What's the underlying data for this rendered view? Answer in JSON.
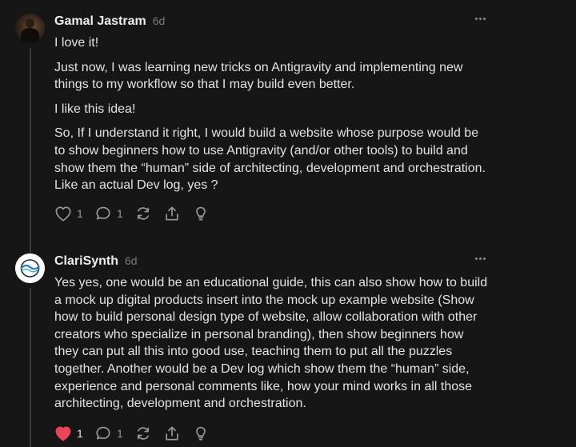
{
  "comments": [
    {
      "author": "Gamal Jastram",
      "time": "6d",
      "avatar": "profile-photo",
      "paragraphs": [
        "I love it!",
        "Just now, I was learning new tricks on Antigravity and implementing new things to my workflow so that I may build even better.",
        "I like this idea!",
        "So, If I understand it right, I would build a website whose purpose would be to show beginners how to use Antigravity (and/or other tools) to build and show them the “human” side of architecting, development and orchestration. Like an actual Dev log, yes ?"
      ],
      "likes": "1",
      "replies": "1",
      "liked": false
    },
    {
      "author": "ClariSynth",
      "time": "6d",
      "avatar": "clarisynth-logo",
      "paragraphs": [
        "Yes yes, one would be an educational guide, this can also show how to build a mock up digital products insert into the mock up example website (Show how to build personal design type of website, allow collaboration with other creators who specialize in personal branding), then show beginners how they can put all this into good use, teaching them to put all the puzzles together. Another would be a Dev log which show them the “human” side, experience and personal comments like, how your mind works in all those architecting, development and orchestration."
      ],
      "likes": "1",
      "replies": "1",
      "liked": true
    }
  ],
  "icons": {
    "like": "heart-icon",
    "reply": "comment-bubble-icon",
    "restack": "restack-icon",
    "share": "share-icon",
    "idea": "lightbulb-icon",
    "more": "more-options-icon"
  },
  "colors": {
    "background": "#161616",
    "liked_heart": "#e8445a",
    "muted_icon": "#9a9a9a"
  }
}
